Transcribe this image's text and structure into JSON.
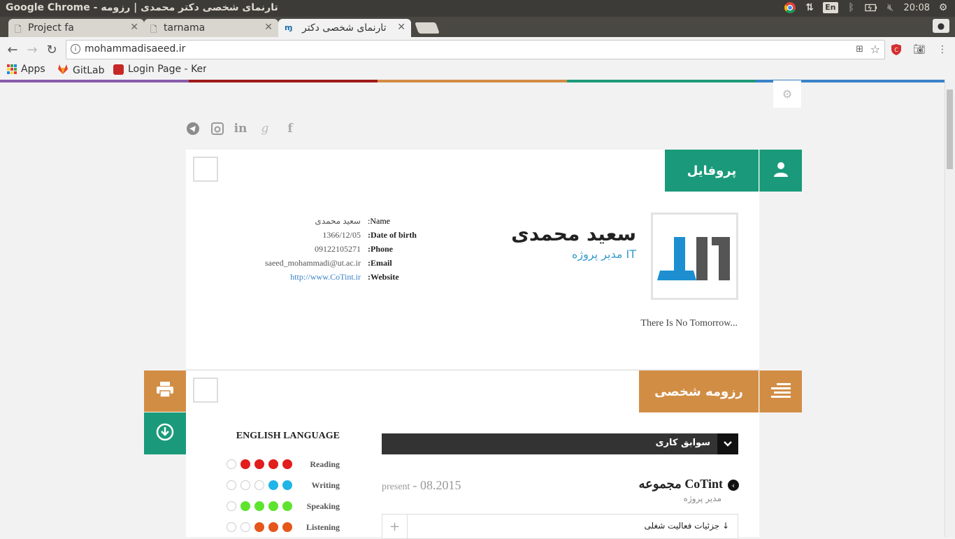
{
  "os": {
    "window_title": "Google Chrome - تارنمای شخصی دکتر محمدی | رزومه",
    "lang": "En",
    "time": "20:08"
  },
  "tabs": [
    {
      "label": "Project fa"
    },
    {
      "label": "tarnama"
    },
    {
      "label": "تارنمای شخصی دکتر"
    }
  ],
  "toolbar": {
    "url": "mohammadisaeed.ir"
  },
  "bookmarks": [
    {
      "label": "Apps"
    },
    {
      "label": "GitLab"
    },
    {
      "label": "Login Page - Keri"
    }
  ],
  "colors": {
    "bar": [
      "#8b5cab",
      "#a01a1a",
      "#d28d45",
      "#1e9a7b",
      "#3a82c8"
    ],
    "green": "#1a9a7a",
    "orange": "#d28d45"
  },
  "profile": {
    "section_title": "پروفایل",
    "name": "سعید محمدی",
    "role": "مدیر پروژه IT",
    "motto": "There Is No Tomorrow...",
    "info": [
      {
        "label": ":Name",
        "value": "سعید محمدی"
      },
      {
        "label": ":Date of birth",
        "value": "1366/12/05"
      },
      {
        "label": ":Phone",
        "value": "09122105271"
      },
      {
        "label": ":Email",
        "value": "saeed_mohammadi@ut.ac.ir"
      },
      {
        "label": ":Website",
        "value": "http://www.CoTint.ir"
      }
    ]
  },
  "resume": {
    "section_title": "رزومه شخصی",
    "work_title": "سوابق کاری",
    "job": {
      "company": "مجموعه CoTint",
      "position": "مدیر پروژه",
      "date_start": "08.2015",
      "date_end": "present",
      "details_label": "جزئیات فعالیت شغلی ↓",
      "expand": "+"
    },
    "language": {
      "title": "ENGLISH LANGUAGE",
      "skills": [
        {
          "name": "Reading",
          "level": 4,
          "color": "#e21d1d"
        },
        {
          "name": "Writing",
          "level": 2,
          "color": "#1fb5e6"
        },
        {
          "name": "Speaking",
          "level": 4,
          "color": "#5ee32f"
        },
        {
          "name": "Listening",
          "level": 3,
          "color": "#e6561b"
        }
      ]
    }
  }
}
